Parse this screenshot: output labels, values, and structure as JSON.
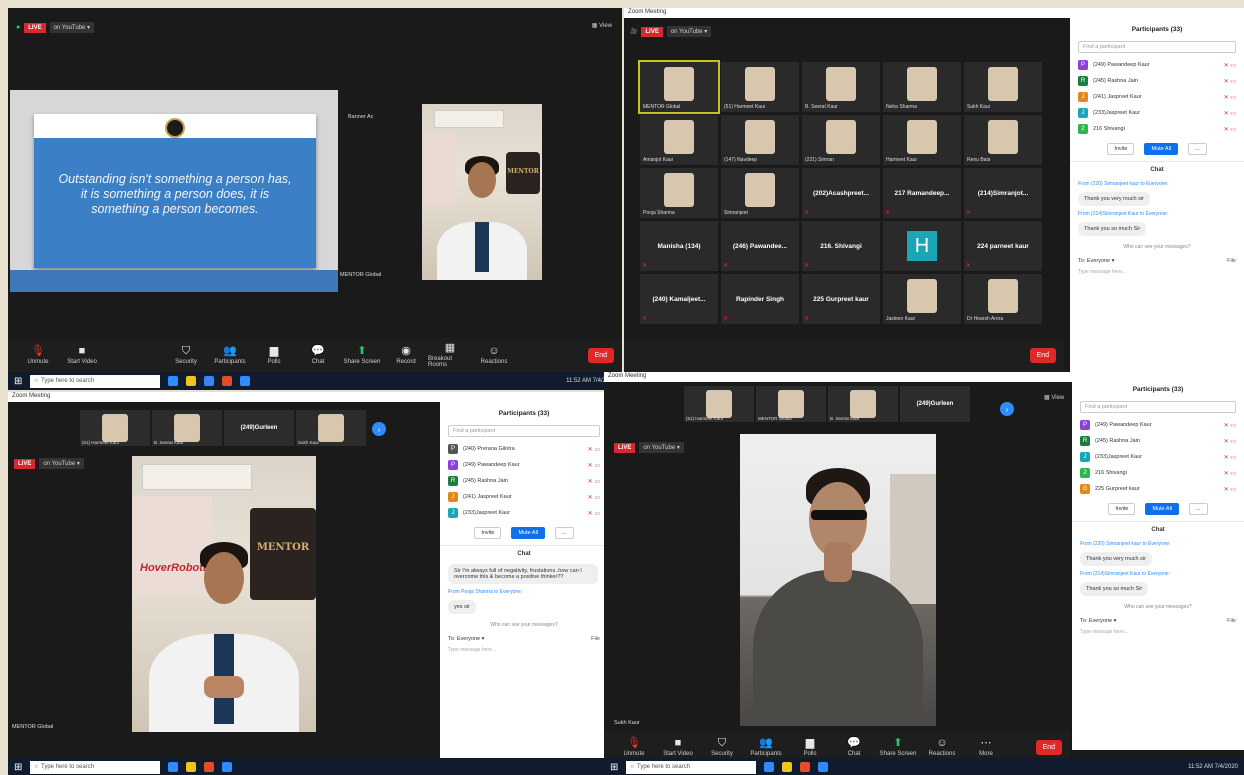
{
  "colors": {
    "live": "#d9272e",
    "zoom_blue": "#0e71eb",
    "end": "#e02828",
    "active_tile": "#c8c21f"
  },
  "common": {
    "live": "LIVE",
    "on_youtube": "on YouTube ▾",
    "view": "▦ View",
    "end": "End",
    "taskbar_search": "Type here to search",
    "clock": "11:52 AM\n7/4/2020"
  },
  "toolbar": {
    "unmute": "Unmute",
    "start_video": "Start Video",
    "security": "Security",
    "participants": "Participants",
    "participants_count": "33",
    "polls": "Polls",
    "chat": "Chat",
    "share_screen": "Share Screen",
    "record": "Record",
    "breakout": "Breakout Rooms",
    "reactions": "Reactions",
    "more": "More"
  },
  "q1": {
    "slide_quote": "Outstanding isn't something a person has, it is something a person does, it is something a person becomes.",
    "name_banner": "Banner Ac",
    "speaker_label": "MENTOR Global",
    "banner_text": "MENTOR"
  },
  "q2": {
    "title": "Zoom Meeting",
    "tiles": [
      {
        "name": "MENTOR Global",
        "photo": true,
        "active": true
      },
      {
        "name": "(51) Harmeet Kaur",
        "photo": true
      },
      {
        "name": "B. Seerat Kaur",
        "photo": true
      },
      {
        "name": "Neha Sharma",
        "photo": true
      },
      {
        "name": "Sukh Kaur",
        "photo": true
      },
      {
        "name": "Amanjot Kaur",
        "photo": true
      },
      {
        "name": "(147) Navdeep",
        "photo": true
      },
      {
        "name": "(221) Simran",
        "photo": true
      },
      {
        "name": "Harmeet Kaur",
        "photo": true
      },
      {
        "name": "Renu Bala",
        "photo": true
      },
      {
        "name": "Pooja Sharma",
        "photo": true
      },
      {
        "name": "Simranjeet",
        "photo": true
      },
      {
        "name": "(202)Acashpreet...",
        "photo": false
      },
      {
        "name": "217 Ramandeep...",
        "photo": false
      },
      {
        "name": "(214)Simranjot...",
        "photo": false
      },
      {
        "name": "Manisha (134)",
        "photo": false
      },
      {
        "name": "(246) Pawandee...",
        "photo": false
      },
      {
        "name": "216. Shivangi",
        "photo": false
      },
      {
        "name": "H",
        "photo": false,
        "letter": true
      },
      {
        "name": "224 parneet kaur",
        "photo": false
      },
      {
        "name": "(240) Kamaljeet...",
        "photo": false
      },
      {
        "name": "Rapinder Singh",
        "photo": false
      },
      {
        "name": "225 Gurpreet kaur",
        "photo": false
      },
      {
        "name": "Jasleen Kaur",
        "photo": true
      },
      {
        "name": "Dr Hearsh Arora",
        "photo": true
      }
    ]
  },
  "panel_tr": {
    "title": "Participants (33)",
    "search": "Find a participant",
    "rows": [
      {
        "initial": "P",
        "color": "#8d3fd9",
        "name": "(249) Pawandeep Kaur"
      },
      {
        "initial": "R",
        "color": "#1f7a3f",
        "name": "(245) Rashna Jain"
      },
      {
        "initial": "J",
        "color": "#e08a1a",
        "name": "(241) Jaspreet Kaur"
      },
      {
        "initial": "J",
        "color": "#1aa6b5",
        "name": "(233)Jaspreet Kaur"
      },
      {
        "initial": "2",
        "color": "#2fb54a",
        "name": "216 Shivangi"
      }
    ],
    "invite": "Invite",
    "mute_all": "Mute All",
    "more": "...",
    "chat_title": "Chat",
    "from1": "From (220) Simranjeet kaur to Everyone:",
    "msg1": "Thank you very much sir",
    "from2": "From (214)Simranjeet Kaur to Everyone:",
    "msg2": "Thank you so much Sir",
    "who": "Who can see your messages?",
    "to": "To: Everyone ▾",
    "file": "File",
    "type": "Type message here..."
  },
  "q3": {
    "title": "Zoom Meeting",
    "strip": [
      {
        "name": "(51) Harmeet Kaur",
        "photo": true
      },
      {
        "name": "B. Seerat Kaur",
        "photo": true
      },
      {
        "name": "(249)Gurleen",
        "photo": false
      },
      {
        "name": "Sukh Kaur",
        "photo": true
      }
    ],
    "speaker_label": "MENTOR Global",
    "banner_text": "MENTOR",
    "brand_text": "HoverRobotix"
  },
  "panel_bl": {
    "title": "Participants (33)",
    "search": "Find a participant",
    "rows": [
      {
        "initial": "P",
        "color": "#555",
        "name": "(240) Prerana Gilotra"
      },
      {
        "initial": "P",
        "color": "#8d3fd9",
        "name": "(249) Pawandeep Kaur"
      },
      {
        "initial": "R",
        "color": "#1f7a3f",
        "name": "(245) Rashna Jain"
      },
      {
        "initial": "J",
        "color": "#e08a1a",
        "name": "(241) Jaspreet Kaur"
      },
      {
        "initial": "J",
        "color": "#1aa6b5",
        "name": "(233)Jaspreet Kaur"
      }
    ],
    "invite": "Invite",
    "mute_all": "Mute All",
    "more": "...",
    "chat_title": "Chat",
    "msg_question": "Sir I'm always full of negativity, frustations..how can I overcome this & become a positive thinker??",
    "from": "From Pooja Sharma to Everyone:",
    "msg": "yes sir",
    "who": "Who can see your messages?",
    "to": "To: Everyone ▾",
    "file": "File",
    "type": "Type message here..."
  },
  "q4": {
    "title": "Zoom Meeting",
    "strip": [
      {
        "name": "(51) Harmeet Kaur",
        "photo": true
      },
      {
        "name": "MENTOR Global",
        "photo": true
      },
      {
        "name": "B. Seerat Kaur",
        "photo": true
      },
      {
        "name": "(249)Gurleen",
        "photo": false
      }
    ],
    "speaker_label": "Sukh Kaur"
  },
  "panel_br": {
    "title": "Participants (33)",
    "search": "Find a participant",
    "rows": [
      {
        "initial": "P",
        "color": "#8d3fd9",
        "name": "(249) Pawandeep Kaur"
      },
      {
        "initial": "R",
        "color": "#1f7a3f",
        "name": "(245) Rashna Jain"
      },
      {
        "initial": "J",
        "color": "#1aa6b5",
        "name": "(233)Jaspreet Kaur"
      },
      {
        "initial": "2",
        "color": "#2fb54a",
        "name": "216 Shivangi"
      },
      {
        "initial": "G",
        "color": "#e08a1a",
        "name": "225 Gurpreet kaur"
      }
    ],
    "invite": "Invite",
    "mute_all": "Mute All",
    "more": "...",
    "chat_title": "Chat",
    "from1": "From (220) Simranjeet kaur to Everyone:",
    "msg1": "Thank you very much sir",
    "from2": "From (214)Simranjeet Kaur to Everyone:",
    "msg2": "Thank you so much Sir",
    "who": "Who can see your messages?",
    "to": "To: Everyone ▾",
    "file": "File",
    "type": "Type message here..."
  }
}
